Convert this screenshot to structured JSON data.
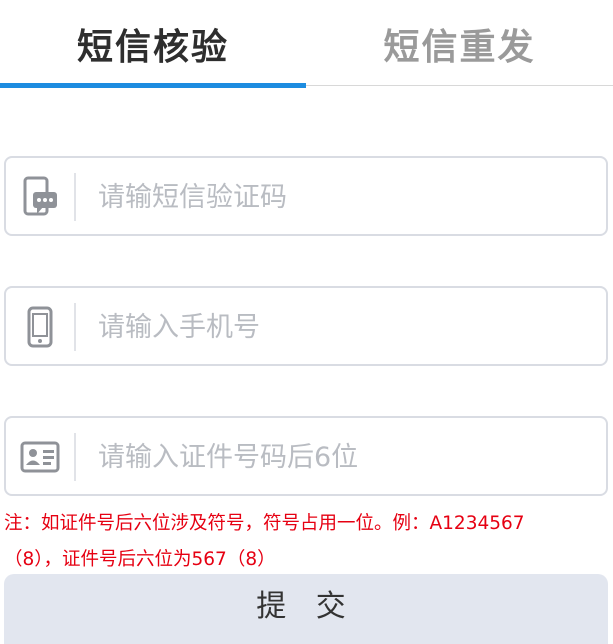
{
  "tabs": [
    {
      "label": "短信核验",
      "active": true
    },
    {
      "label": "短信重发",
      "active": false
    }
  ],
  "fields": {
    "sms_code": {
      "placeholder": "请输短信验证码",
      "value": "",
      "icon": "sms-chat-icon"
    },
    "phone": {
      "placeholder": "请输入手机号",
      "value": "",
      "icon": "mobile-phone-icon"
    },
    "id_number": {
      "placeholder": "请输入证件号码后6位",
      "value": "",
      "icon": "id-card-icon"
    }
  },
  "note": {
    "line1": "注：如证件号后六位涉及符号，符号占用一位。例：A1234567",
    "line2": "（8），证件号后六位为567（8）"
  },
  "submit_label": "提 交",
  "colors": {
    "accent": "#1d8ce0",
    "note": "#e60012",
    "button_bg": "#e2e6ef"
  }
}
